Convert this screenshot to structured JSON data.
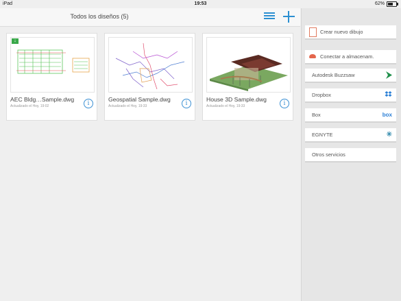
{
  "status_bar": {
    "device": "iPad",
    "time": "19:53",
    "battery": "62%",
    "battery_level": 0.62
  },
  "header": {
    "title": "Todos los diseños (5)",
    "list_icon": "list-view-icon",
    "add_icon": "plus-icon"
  },
  "cards": [
    {
      "name": "AEC Bldg…Sample.dwg",
      "updated": "Actualizado el Hoy, 19:02",
      "thumb": "aec-building-plan",
      "badge": "↓"
    },
    {
      "name": "Geospatial Sample.dwg",
      "updated": "Actualizado el Hoy, 19:33",
      "thumb": "geospatial-map"
    },
    {
      "name": "House 3D Sample.dwg",
      "updated": "Actualizado el Hoy, 19:33",
      "thumb": "house-3d-model"
    }
  ],
  "sidebar": {
    "create": "Crear nuevo dibujo",
    "connect": "Conectar a almacenam.",
    "services": [
      {
        "label": "Autodesk Buzzsaw",
        "icon": "buzzsaw-icon",
        "color": "#1f8f4a"
      },
      {
        "label": "Dropbox",
        "icon": "dropbox-icon",
        "color": "#2b7fd6"
      },
      {
        "label": "Box",
        "icon": "box-icon",
        "color": "#2b7fd6",
        "glyph": "box"
      },
      {
        "label": "EGNYTE",
        "icon": "egnyte-icon",
        "color": "#3a8fb0",
        "glyph": "✳"
      },
      {
        "label": "Otros servicios"
      }
    ]
  },
  "colors": {
    "accent": "#2b8fd1",
    "card_bg": "#ffffff",
    "panel_bg": "#e6e6e6"
  }
}
